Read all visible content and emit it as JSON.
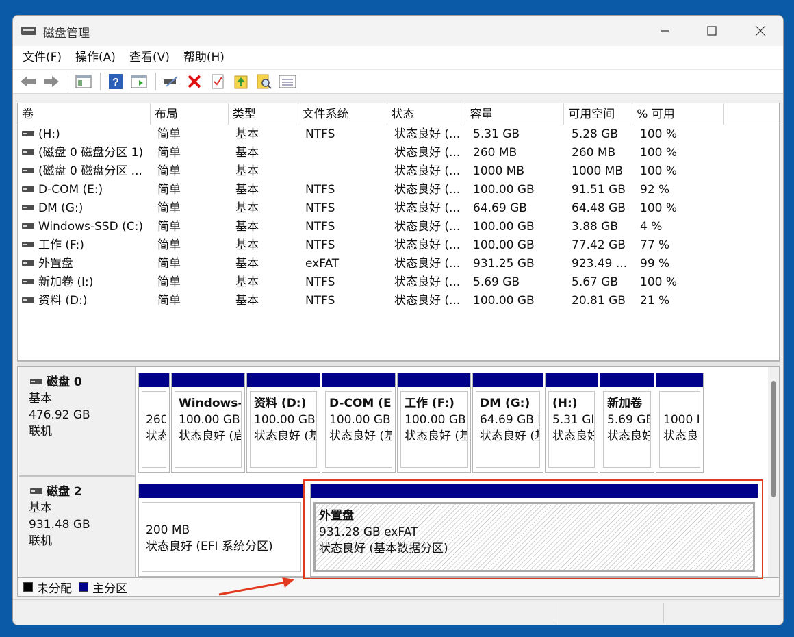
{
  "window": {
    "title": "磁盘管理",
    "minimize_icon": "minimize-icon",
    "maximize_icon": "maximize-icon",
    "close_icon": "close-icon"
  },
  "menu": [
    "文件(F)",
    "操作(A)",
    "查看(V)",
    "帮助(H)"
  ],
  "toolbar": [
    "back-icon",
    "forward-icon",
    "console-tree-icon",
    "help-icon",
    "action-pane-icon",
    "connect-disk-icon",
    "delete-icon",
    "properties-icon",
    "export-icon",
    "search-icon",
    "settings-icon"
  ],
  "table": {
    "columns": [
      "卷",
      "布局",
      "类型",
      "文件系统",
      "状态",
      "容量",
      "可用空间",
      "% 可用"
    ],
    "rows": [
      [
        "(H:)",
        "简单",
        "基本",
        "NTFS",
        "状态良好 (...",
        "5.31 GB",
        "5.28 GB",
        "100 %"
      ],
      [
        "(磁盘 0 磁盘分区 1)",
        "简单",
        "基本",
        "",
        "状态良好 (...",
        "260 MB",
        "260 MB",
        "100 %"
      ],
      [
        "(磁盘 0 磁盘分区 ...",
        "简单",
        "基本",
        "",
        "状态良好 (...",
        "1000 MB",
        "1000 MB",
        "100 %"
      ],
      [
        "D-COM (E:)",
        "简单",
        "基本",
        "NTFS",
        "状态良好 (...",
        "100.00 GB",
        "91.51 GB",
        "92 %"
      ],
      [
        "DM (G:)",
        "简单",
        "基本",
        "NTFS",
        "状态良好 (...",
        "64.69 GB",
        "64.48 GB",
        "100 %"
      ],
      [
        "Windows-SSD (C:)",
        "简单",
        "基本",
        "NTFS",
        "状态良好 (...",
        "100.00 GB",
        "3.88 GB",
        "4 %"
      ],
      [
        "工作 (F:)",
        "简单",
        "基本",
        "NTFS",
        "状态良好 (...",
        "100.00 GB",
        "77.42 GB",
        "77 %"
      ],
      [
        "外置盘",
        "简单",
        "基本",
        "exFAT",
        "状态良好 (...",
        "931.25 GB",
        "923.49 ...",
        "99 %"
      ],
      [
        "新加卷 (I:)",
        "简单",
        "基本",
        "NTFS",
        "状态良好 (...",
        "5.69 GB",
        "5.67 GB",
        "100 %"
      ],
      [
        "资料 (D:)",
        "简单",
        "基本",
        "NTFS",
        "状态良好 (...",
        "100.00 GB",
        "20.81 GB",
        "21 %"
      ]
    ]
  },
  "disks": [
    {
      "name": "磁盘 0",
      "type": "基本",
      "size": "476.92 GB",
      "status": "联机",
      "partitions": [
        {
          "title": "",
          "size": "260",
          "status": "状态"
        },
        {
          "title": "Windows-",
          "size": "100.00 GB",
          "status": "状态良好 (启"
        },
        {
          "title": "资料  (D:)",
          "size": "100.00 GB",
          "status": "状态良好 (基"
        },
        {
          "title": "D-COM  (E",
          "size": "100.00 GB",
          "status": "状态良好 (基"
        },
        {
          "title": "工作  (F:)",
          "size": "100.00 GB",
          "status": "状态良好 (基"
        },
        {
          "title": "DM  (G:)",
          "size": "64.69 GB I",
          "status": "状态良好 (基"
        },
        {
          "title": "(H:)",
          "size": "5.31 GI",
          "status": "状态良好"
        },
        {
          "title": "新加卷",
          "size": "5.69 GE",
          "status": "状态良好"
        },
        {
          "title": "",
          "size": "1000 I",
          "status": "状态良"
        }
      ]
    },
    {
      "name": "磁盘 2",
      "type": "基本",
      "size": "931.48 GB",
      "status": "联机",
      "partitions": [
        {
          "title": "",
          "size": "200 MB",
          "status": "状态良好 (EFI 系统分区)"
        },
        {
          "title": "外置盘",
          "size": "931.28 GB exFAT",
          "status": "状态良好 (基本数据分区)"
        }
      ]
    }
  ],
  "legend": {
    "unallocated": "未分配",
    "primary": "主分区",
    "unallocated_color": "#000000",
    "primary_color": "#00008b"
  },
  "colors": {
    "partition_bar": "#00008b",
    "highlight": "#e23a1e",
    "background": "#0a5aa8"
  }
}
